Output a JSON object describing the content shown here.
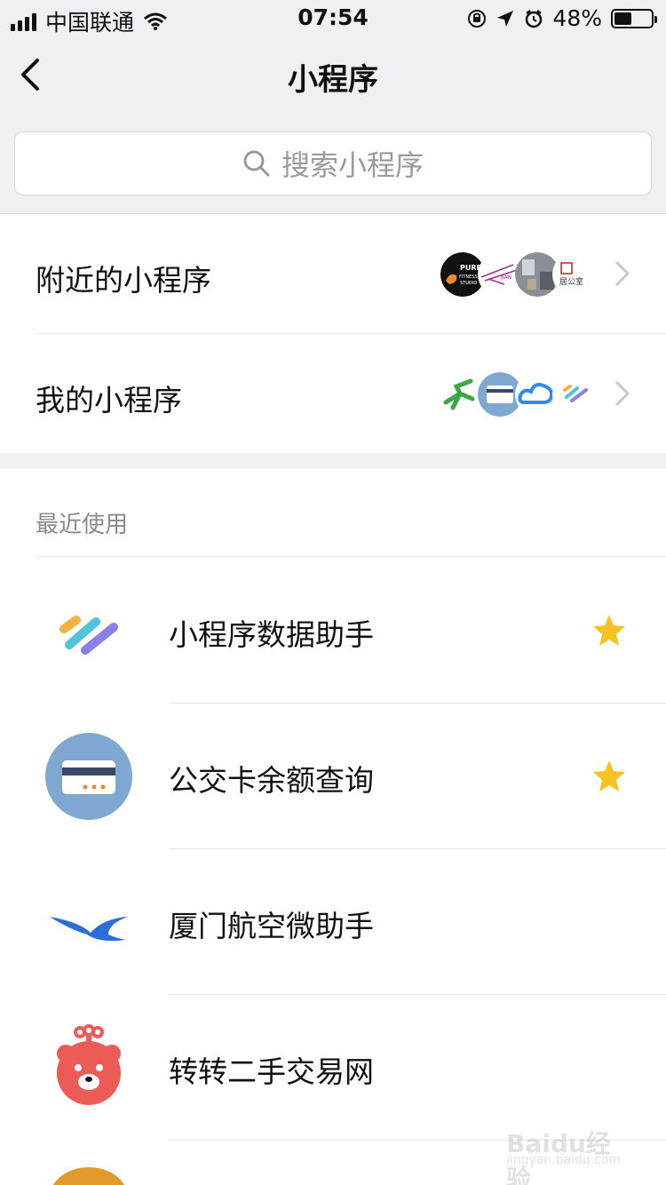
{
  "status_bar": {
    "carrier": "中国联通",
    "time": "07:54",
    "battery": "48%",
    "battery_level": 0.48,
    "icons": [
      "signal-icon",
      "wifi-icon",
      "orientation-lock-icon",
      "location-icon",
      "alarm-icon",
      "battery-icon"
    ]
  },
  "nav": {
    "title": "小程序",
    "back_icon": "chevron-left-icon"
  },
  "search": {
    "placeholder": "搜索小程序",
    "icon": "search-icon"
  },
  "menu": [
    {
      "label": "附近的小程序",
      "icon": "chevron-right-icon"
    },
    {
      "label": "我的小程序",
      "icon": "chevron-right-icon"
    }
  ],
  "nearby_thumbs": {
    "first": {
      "line1": "PURE",
      "line2": "FITNESS",
      "line3": "STUDIO"
    },
    "second": {
      "line1": "JIAN"
    },
    "fourth": {
      "line1": "居公室"
    }
  },
  "recent": {
    "label": "最近使用",
    "apps": [
      {
        "name": "小程序数据助手",
        "icon": "stripes-icon",
        "starred": true
      },
      {
        "name": "公交卡余额查询",
        "icon": "bus-card-icon",
        "starred": true
      },
      {
        "name": "厦门航空微助手",
        "icon": "xiamen-airlines-icon",
        "starred": false
      },
      {
        "name": "转转二手交易网",
        "icon": "bear-icon",
        "starred": false
      }
    ]
  },
  "colors": {
    "background": "#efeff4",
    "star": "#f7c324",
    "bus_card": "#7ea8cf",
    "bear": "#ec5b56",
    "airline": "#2b6fd6"
  },
  "watermark": {
    "text": "Baidu经验",
    "sub": "jingyan.baidu.com"
  }
}
